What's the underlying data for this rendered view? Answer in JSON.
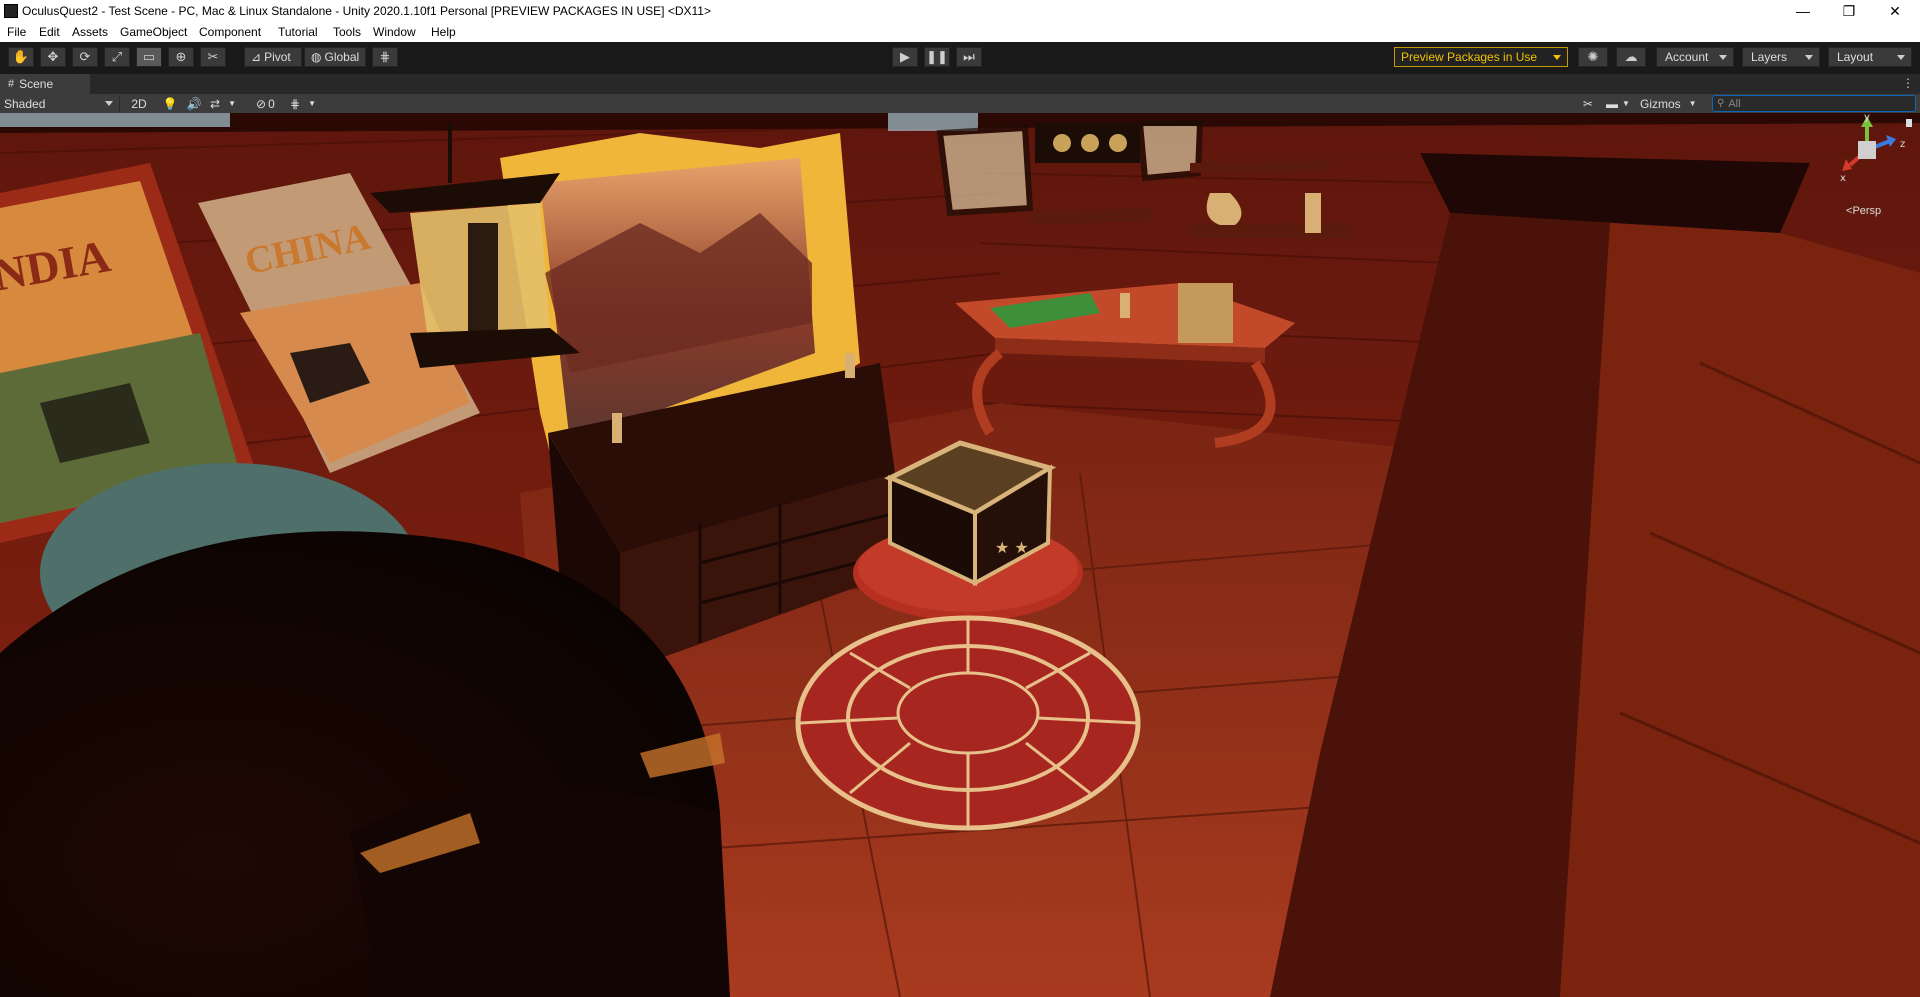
{
  "window": {
    "title": "OculusQuest2 - Test Scene - PC, Mac & Linux Standalone - Unity 2020.1.10f1 Personal [PREVIEW PACKAGES IN USE] <DX11>",
    "minimize": "—",
    "maximize": "❐",
    "close": "✕"
  },
  "menu": [
    "File",
    "Edit",
    "Assets",
    "GameObject",
    "Component",
    "Tutorial",
    "Tools",
    "Window",
    "Help"
  ],
  "toolbar": {
    "pivot_label": "Pivot",
    "global_label": "Global",
    "preview_label": "Preview Packages in Use",
    "account_label": "Account",
    "layers_label": "Layers",
    "layout_label": "Layout"
  },
  "scene_tab": {
    "label": "Scene"
  },
  "scene_toolbar": {
    "shading_mode": "Shaded",
    "mode_2d": "2D",
    "hidden_count": "0",
    "gizmos_label": "Gizmos",
    "search_placeholder": "All"
  },
  "orientation_gizmo": {
    "y_label": "y",
    "x_label": "x",
    "z_label": "z",
    "projection_label": "Persp"
  },
  "scene_content": {
    "poster_india": "NDIA",
    "poster_china": "CHINA"
  },
  "colors": {
    "accent_preview": "#f2c200",
    "search_border": "#0f66b8",
    "wall": "#7a1d10",
    "floor": "#8a2a17"
  }
}
